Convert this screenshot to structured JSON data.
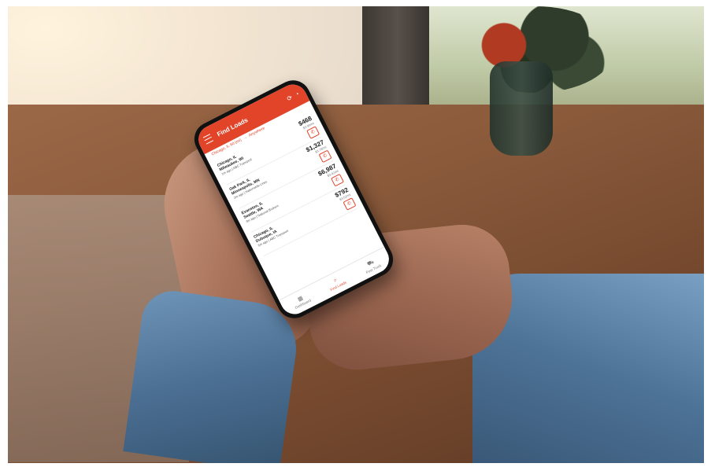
{
  "app": {
    "title": "Find Loads",
    "icons": [
      "menu-icon",
      "refresh-icon",
      "notification-icon"
    ]
  },
  "search": {
    "origin": "Chicago, IL 60 (mi)",
    "destination": "Anywhere"
  },
  "loads": [
    {
      "origin": "Chicago, IL",
      "destination": "Milwaukee, WI",
      "price": "$468",
      "rate": "$3.90/mi",
      "age": "1m ago | ABC Transport"
    },
    {
      "origin": "Oak Park, IL",
      "destination": "Minneapolis, MN",
      "price": "$1,327",
      "rate": "$3.78/mi",
      "age": "2m ago | Nationwide Lines"
    },
    {
      "origin": "Evanston, IL",
      "destination": "Seattle, WA",
      "price": "$6,987",
      "rate": "$3.42/mi",
      "age": "3m ago | National Brokers"
    },
    {
      "origin": "Chicago, IL",
      "destination": "Dubuque, IA",
      "price": "$792",
      "rate": "$3.52/mi",
      "age": "5m ago | ABC Transport"
    }
  ],
  "nav": {
    "items": [
      {
        "label": "Dashboard",
        "icon": "grid-icon"
      },
      {
        "label": "Find Loads",
        "icon": "search-icon",
        "active": true
      },
      {
        "label": "Post Truck",
        "icon": "truck-icon"
      }
    ]
  },
  "colors": {
    "accent": "#e2442a"
  }
}
